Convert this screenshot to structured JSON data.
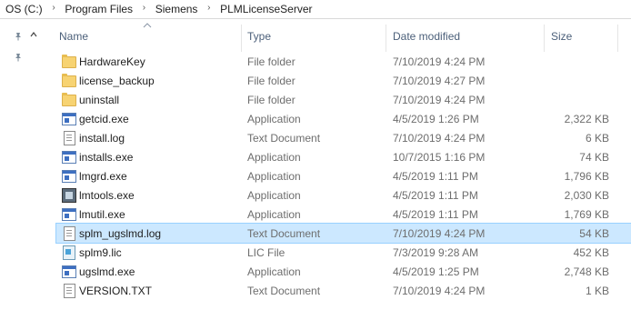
{
  "breadcrumb": [
    "OS (C:)",
    "Program Files",
    "Siemens",
    "PLMLicenseServer"
  ],
  "separator": "›",
  "columns": {
    "name": "Name",
    "type": "Type",
    "date": "Date modified",
    "size": "Size"
  },
  "files": [
    {
      "name": "HardwareKey",
      "type": "File folder",
      "date": "7/10/2019 4:24 PM",
      "size": "",
      "icon": "folder-icon"
    },
    {
      "name": "license_backup",
      "type": "File folder",
      "date": "7/10/2019 4:27 PM",
      "size": "",
      "icon": "folder-icon"
    },
    {
      "name": "uninstall",
      "type": "File folder",
      "date": "7/10/2019 4:24 PM",
      "size": "",
      "icon": "folder-icon"
    },
    {
      "name": "getcid.exe",
      "type": "Application",
      "date": "4/5/2019 1:26 PM",
      "size": "2,322 KB",
      "icon": "application-icon"
    },
    {
      "name": "install.log",
      "type": "Text Document",
      "date": "7/10/2019 4:24 PM",
      "size": "6 KB",
      "icon": "text-document-icon"
    },
    {
      "name": "installs.exe",
      "type": "Application",
      "date": "10/7/2015 1:16 PM",
      "size": "74 KB",
      "icon": "application-icon"
    },
    {
      "name": "lmgrd.exe",
      "type": "Application",
      "date": "4/5/2019 1:11 PM",
      "size": "1,796 KB",
      "icon": "application-icon"
    },
    {
      "name": "lmtools.exe",
      "type": "Application",
      "date": "4/5/2019 1:11 PM",
      "size": "2,030 KB",
      "icon": "lmtools-icon"
    },
    {
      "name": "lmutil.exe",
      "type": "Application",
      "date": "4/5/2019 1:11 PM",
      "size": "1,769 KB",
      "icon": "application-icon"
    },
    {
      "name": "splm_ugslmd.log",
      "type": "Text Document",
      "date": "7/10/2019 4:24 PM",
      "size": "54 KB",
      "icon": "text-document-icon",
      "selected": true
    },
    {
      "name": "splm9.lic",
      "type": "LIC File",
      "date": "7/3/2019 9:28 AM",
      "size": "452 KB",
      "icon": "license-file-icon"
    },
    {
      "name": "ugslmd.exe",
      "type": "Application",
      "date": "4/5/2019 1:25 PM",
      "size": "2,748 KB",
      "icon": "application-icon"
    },
    {
      "name": "VERSION.TXT",
      "type": "Text Document",
      "date": "7/10/2019 4:24 PM",
      "size": "1 KB",
      "icon": "text-document-icon"
    }
  ],
  "colors": {
    "selection_bg": "#cce8ff",
    "selection_border": "#99d1ff",
    "header_text": "#4c607a"
  }
}
